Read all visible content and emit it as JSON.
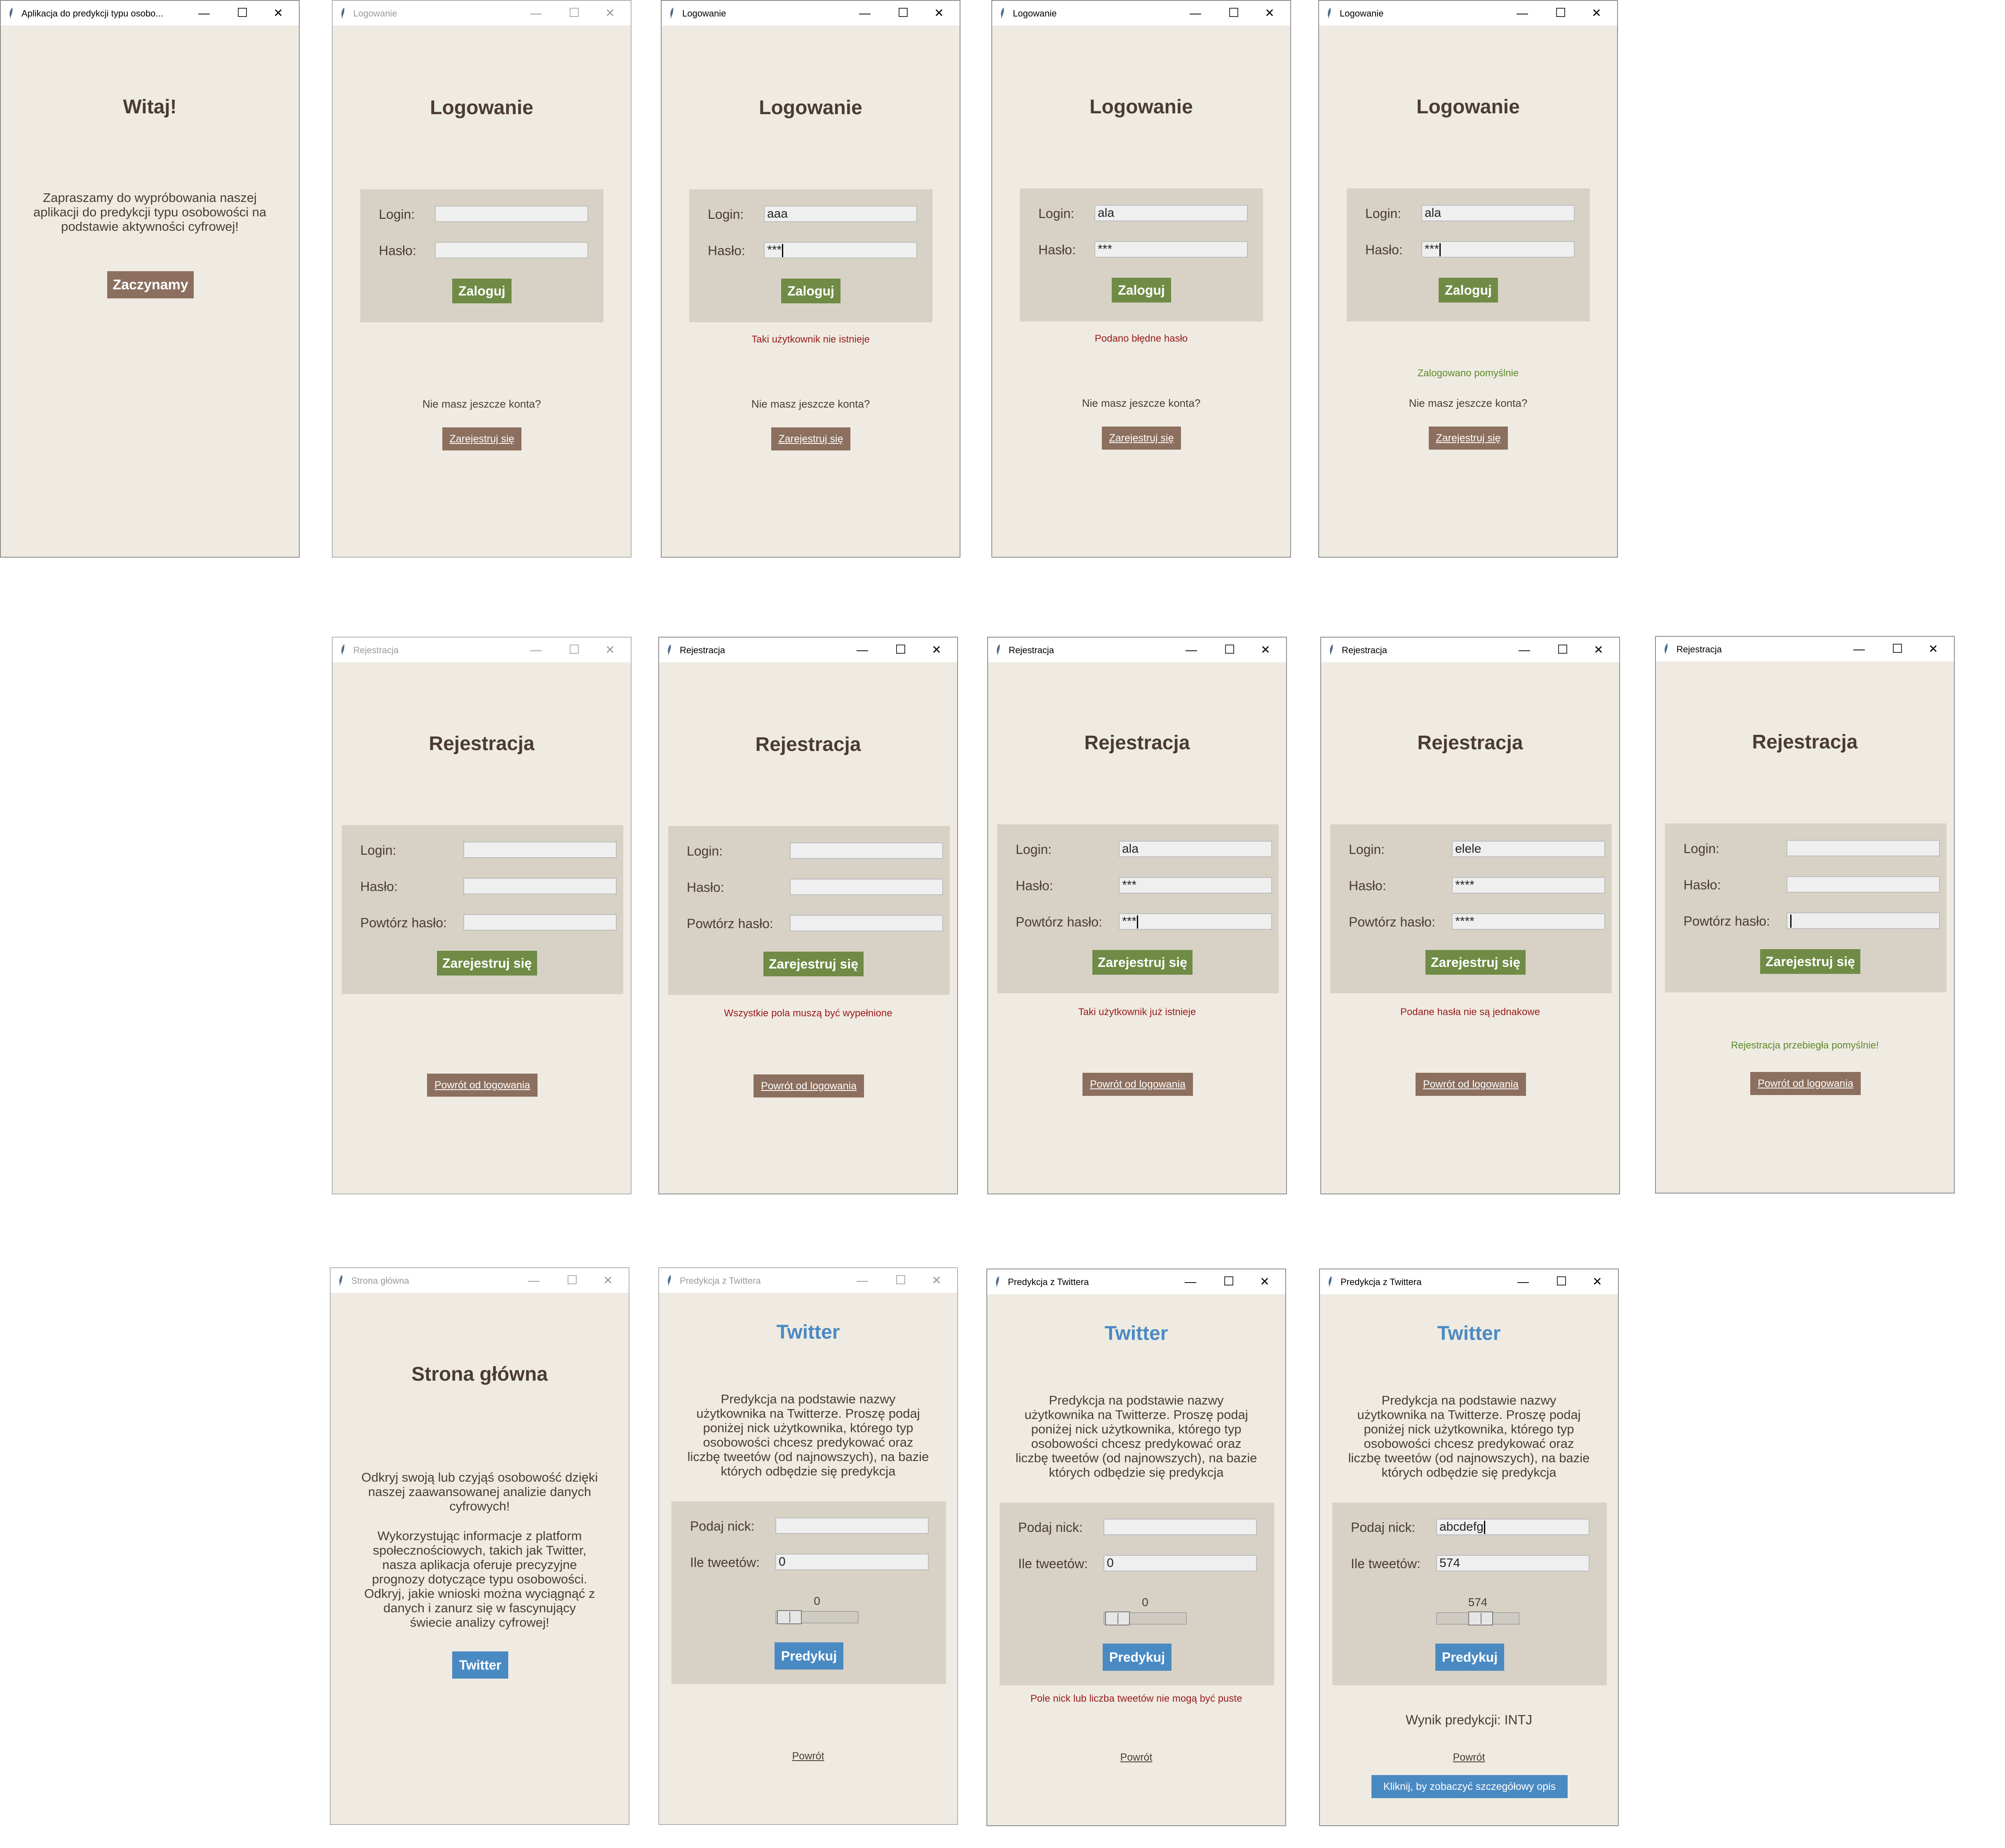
{
  "ui": {
    "min_glyph": "—",
    "max_glyph": "☐",
    "close_glyph": "✕"
  },
  "colors": {
    "background": "#efebe2",
    "panel": "#d8d2c6",
    "green": "#6f8b45",
    "blue": "#4a8ac3",
    "brown": "#8c6f5e",
    "error": "#9b1a1a",
    "success": "#5c8a2a"
  },
  "welcome": {
    "window_title": "Aplikacja do predykcji typu osobo...",
    "heading": "Witaj!",
    "text_lines": [
      "Zapraszamy do wypróbowania naszej",
      "aplikacji do predykcji typu osobowości na",
      "podstawie aktywności cyfrowej!"
    ],
    "start_button": "Zaczynamy"
  },
  "login": {
    "window_title": "Logowanie",
    "heading": "Logowanie",
    "login_label": "Login:",
    "password_label": "Hasło:",
    "submit_button": "Zaloguj",
    "no_account_text": "Nie masz jeszcze konta?",
    "register_button": "Zarejestruj się",
    "screens": [
      {
        "login_value": "",
        "password_value": "",
        "message": ""
      },
      {
        "login_value": "aaa",
        "password_value": "***",
        "message": "Taki użytkownik nie istnieje"
      },
      {
        "login_value": "ala",
        "password_value": "***",
        "message": "Podano błędne hasło"
      },
      {
        "login_value": "ala",
        "password_value": "***",
        "message": "Zalogowano pomyślnie"
      }
    ]
  },
  "register": {
    "window_title": "Rejestracja",
    "heading": "Rejestracja",
    "login_label": "Login:",
    "password_label": "Hasło:",
    "repeat_label": "Powtórz hasło:",
    "submit_button": "Zarejestruj się",
    "back_button": "Powrót od logowania",
    "screens": [
      {
        "login_value": "",
        "password_value": "",
        "repeat_value": "",
        "message": ""
      },
      {
        "login_value": "",
        "password_value": "",
        "repeat_value": "",
        "message": "Wszystkie pola muszą być wypełnione"
      },
      {
        "login_value": "ala",
        "password_value": "***",
        "repeat_value": "***",
        "message": "Taki użytkownik już istnieje"
      },
      {
        "login_value": "elele",
        "password_value": "****",
        "repeat_value": "****",
        "message": "Podane hasła nie są jednakowe"
      },
      {
        "login_value": "",
        "password_value": "",
        "repeat_value": "",
        "message": "Rejestracja przebiegła pomyślnie!"
      }
    ]
  },
  "home": {
    "window_title": "Strona główna",
    "heading": "Strona główna",
    "paragraph1": [
      "Odkryj swoją lub czyjąś osobowość dzięki",
      "naszej zaawansowanej analizie danych",
      "cyfrowych!"
    ],
    "paragraph2": [
      "Wykorzystując informacje z platform",
      "społecznościowych, takich jak Twitter,",
      "nasza aplikacja oferuje precyzyjne",
      "prognozy dotyczące typu osobowości.",
      "Odkryj, jakie wnioski można wyciągnąć z",
      "danych i zanurz się w fascynujący",
      "świecie analizy cyfrowej!"
    ],
    "twitter_button": "Twitter"
  },
  "twitter": {
    "window_title": "Predykcja z Twittera",
    "heading": "Twitter",
    "description": [
      "Predykcja na podstawie nazwy",
      "użytkownika na Twitterze. Proszę podaj",
      "poniżej nick użytkownika, którego typ",
      "osobowości chcesz predykować oraz",
      "liczbę tweetów (od najnowszych), na bazie",
      "których odbędzie się predykcja"
    ],
    "nick_label": "Podaj nick:",
    "tweets_label": "Ile tweetów:",
    "predict_button": "Predykuj",
    "back_link": "Powrót",
    "slider_max": 3200,
    "screens": [
      {
        "nick_value": "",
        "tweets_value": "0",
        "slider_value": "0",
        "slider_fraction": 0,
        "message": "",
        "result": "",
        "detail_button": ""
      },
      {
        "nick_value": "",
        "tweets_value": "0",
        "slider_value": "0",
        "slider_fraction": 0,
        "message": "Pole nick lub liczba tweetów nie mogą być puste",
        "result": "",
        "detail_button": ""
      },
      {
        "nick_value": "abcdefg",
        "tweets_value": "574",
        "slider_value": "574",
        "slider_fraction": 0.55,
        "message": "",
        "result": "Wynik predykcji: INTJ",
        "detail_button": "Kliknij, by zobaczyć szczegółowy opis"
      }
    ]
  }
}
